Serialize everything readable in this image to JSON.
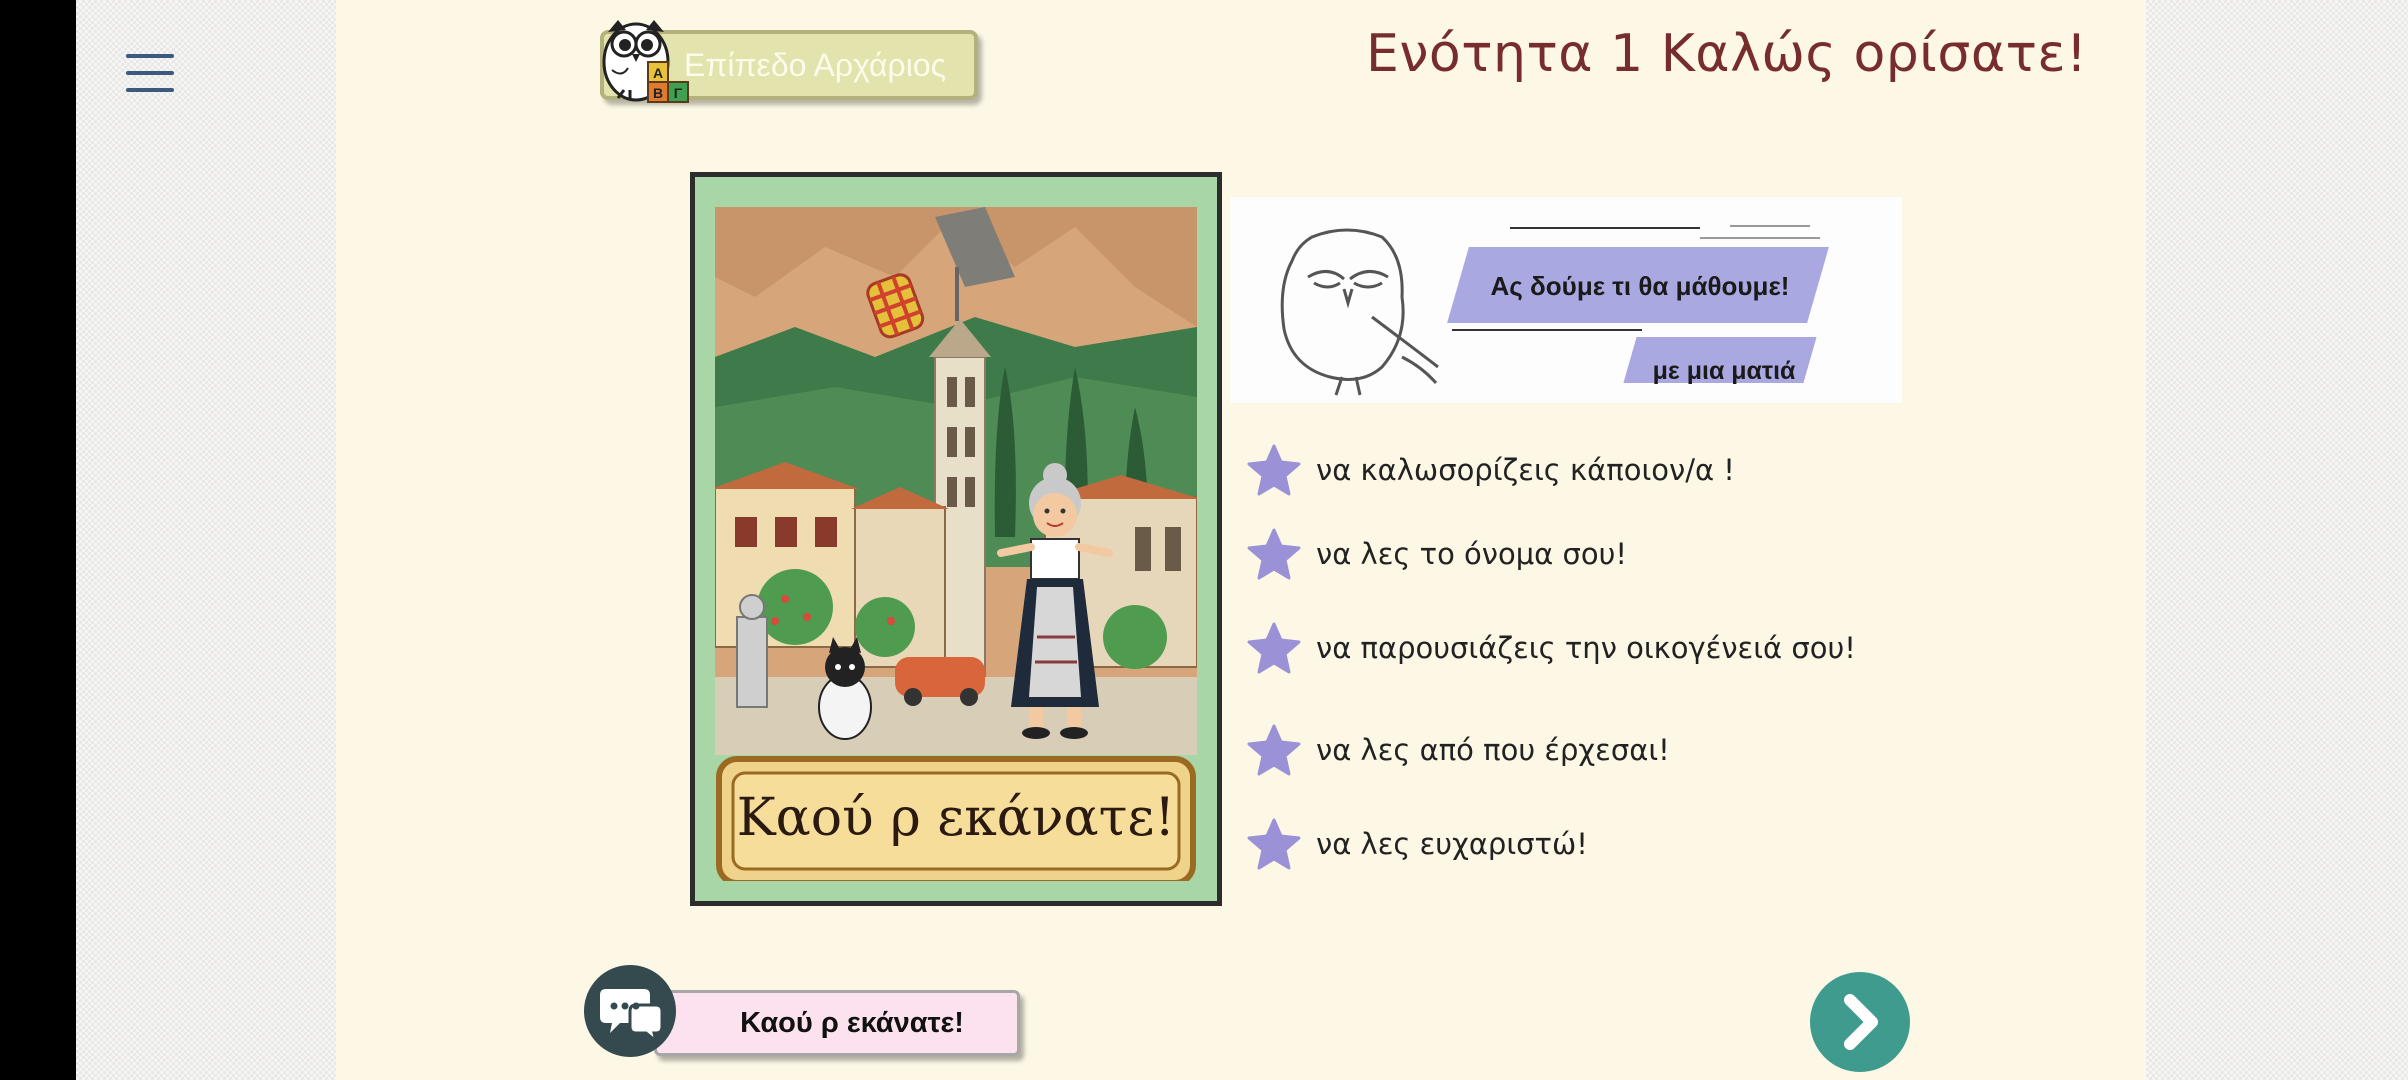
{
  "menu": {
    "icon": "hamburger-menu-icon"
  },
  "header": {
    "level_label": "Επίπεδο Αρχάριος",
    "unit_title": "Ενότητα 1 Καλώς ορίσατε!",
    "logo_blocks": [
      "A",
      "B",
      "Γ"
    ]
  },
  "illustration": {
    "sign_text": "Καού ρ εκάνατε!"
  },
  "learn_banner": {
    "line1": "Ας δούμε τι θα μάθουμε!",
    "line2": "με μια ματιά"
  },
  "goals": [
    "να καλωσορίζεις κάποιον/α !",
    "να λες το όνομα σου!",
    "να παρουσιάζεις την οικογένειά σου!",
    "να λες από που έρχεσαι!",
    "να λες ευχαριστώ!"
  ],
  "phrase_button": {
    "label": "Καού ρ εκάνατε!",
    "icon": "speech-bubble-icon"
  },
  "next_button": {
    "icon": "chevron-right-icon"
  },
  "colors": {
    "page_bg": "#fdf8e6",
    "title": "#772d2d",
    "star": "#9b91d6",
    "next": "#3f9b8d",
    "banner_strip": "#a9a8e0"
  }
}
